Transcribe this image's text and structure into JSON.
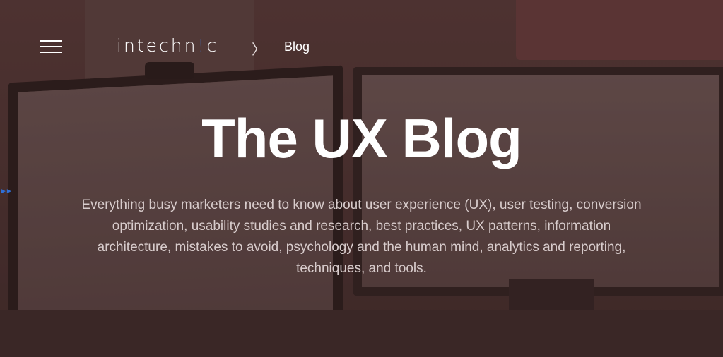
{
  "header": {
    "logo_pre": "intechn",
    "logo_bang": "!",
    "logo_post": "c",
    "breadcrumb_separator": "〉",
    "breadcrumb_current": "Blog"
  },
  "hero": {
    "title": "The UX Blog",
    "subtitle": "Everything busy marketers need to know about user experience (UX), user testing, conversion optimization, usability studies and research, best practices, UX patterns, information architecture, mistakes to avoid, psychology and the human mind, analytics and reporting, techniques, and tools."
  },
  "icons": {
    "menu": "hamburger-menu-icon",
    "side": "double-arrow-right-icon"
  },
  "colors": {
    "accent": "#3a7de0",
    "text": "#ffffff",
    "subtitle": "#d8cccc",
    "background": "#4a3432"
  }
}
